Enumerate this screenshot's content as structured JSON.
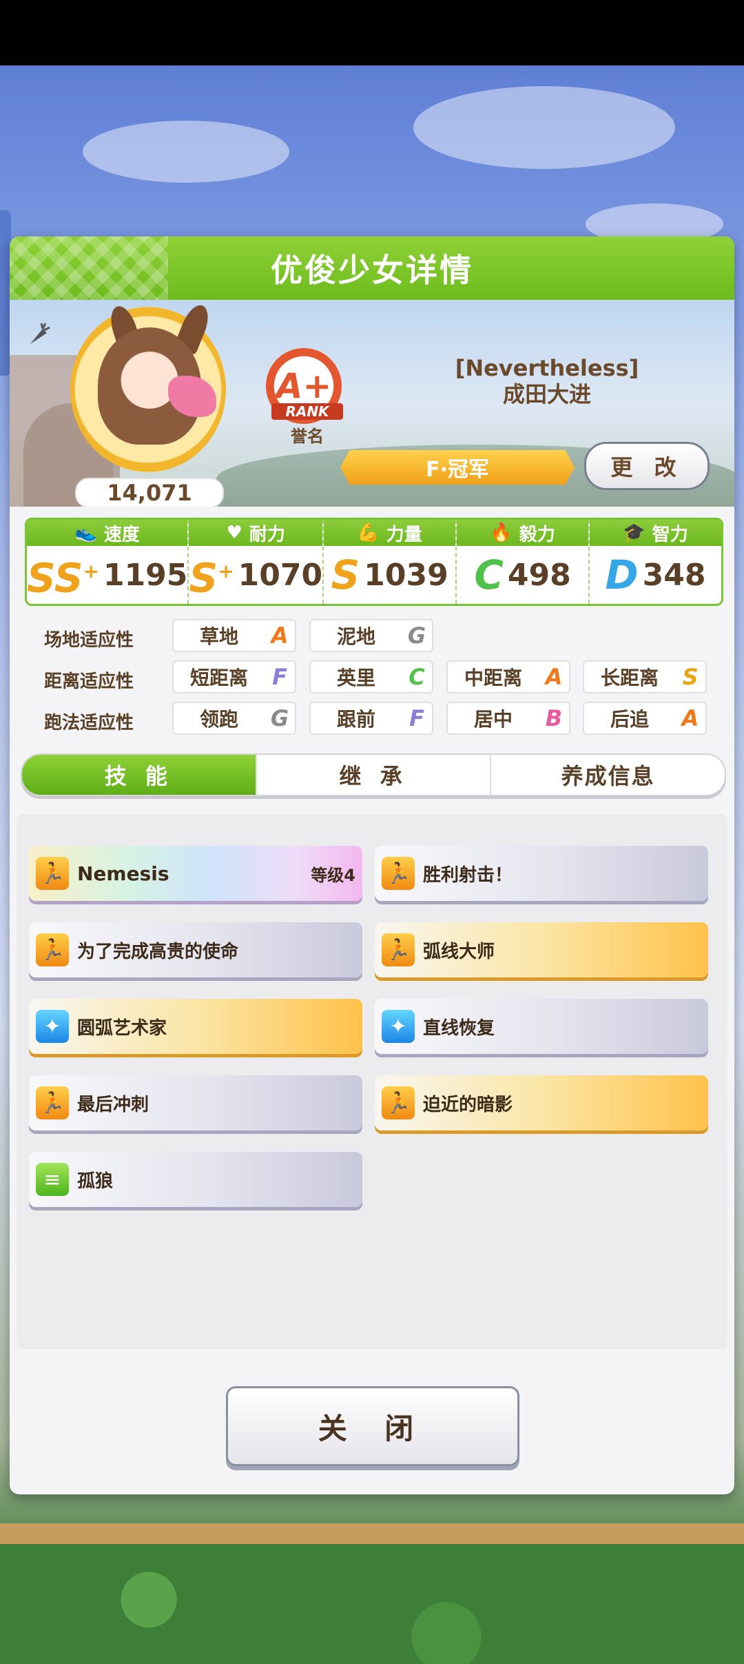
{
  "header": {
    "title": "优俊少女详情"
  },
  "profile": {
    "fan_count": "14,071",
    "rank_grade": "A+",
    "rank_text": "RANK",
    "rank_label": "誉名",
    "epithet": "[Nevertheless]",
    "name": "成田大进",
    "title": "F·冠军",
    "change_button": "更 改"
  },
  "stats": [
    {
      "label": "速度",
      "icon": "speed-icon",
      "glyph": "👟",
      "grade": "SS",
      "plus": "+",
      "value": "1195"
    },
    {
      "label": "耐力",
      "icon": "heart-icon",
      "glyph": "♥",
      "grade": "S",
      "plus": "+",
      "value": "1070"
    },
    {
      "label": "力量",
      "icon": "muscle-icon",
      "glyph": "💪",
      "grade": "S",
      "plus": "",
      "value": "1039"
    },
    {
      "label": "毅力",
      "icon": "flame-icon",
      "glyph": "🔥",
      "grade": "C",
      "plus": "",
      "value": "498"
    },
    {
      "label": "智力",
      "icon": "graduation-cap-icon",
      "glyph": "🎓",
      "grade": "D",
      "plus": "",
      "value": "348"
    }
  ],
  "aptitude": {
    "track": {
      "label": "场地适应性",
      "items": [
        {
          "name": "草地",
          "grade": "A"
        },
        {
          "name": "泥地",
          "grade": "G"
        }
      ]
    },
    "distance": {
      "label": "距离适应性",
      "items": [
        {
          "name": "短距离",
          "grade": "F"
        },
        {
          "name": "英里",
          "grade": "C"
        },
        {
          "name": "中距离",
          "grade": "A"
        },
        {
          "name": "长距离",
          "grade": "S"
        }
      ]
    },
    "style": {
      "label": "跑法适应性",
      "items": [
        {
          "name": "领跑",
          "grade": "G"
        },
        {
          "name": "跟前",
          "grade": "F"
        },
        {
          "name": "居中",
          "grade": "B"
        },
        {
          "name": "后追",
          "grade": "A"
        }
      ]
    }
  },
  "tabs": [
    {
      "label": "技 能"
    },
    {
      "label": "继 承"
    },
    {
      "label": "养成信息"
    }
  ],
  "skills": [
    {
      "name": "Nemesis",
      "level": "等级4",
      "type": "speed-icon"
    },
    {
      "name": "胜利射击！",
      "level": "",
      "type": "speed-icon"
    },
    {
      "name": "为了完成高贵的使命",
      "level": "",
      "type": "speed-icon"
    },
    {
      "name": "弧线大师",
      "level": "",
      "type": "speed-icon"
    },
    {
      "name": "圆弧艺术家",
      "level": "",
      "type": "recovery-icon"
    },
    {
      "name": "直线恢复",
      "level": "",
      "type": "recovery-icon"
    },
    {
      "name": "最后冲刺",
      "level": "",
      "type": "speed-icon"
    },
    {
      "name": "迫近的暗影",
      "level": "",
      "type": "speed-icon"
    },
    {
      "name": "孤狼",
      "level": "",
      "type": "debuff-icon"
    }
  ],
  "close_button": "关 闭",
  "colors": {
    "accent_green": "#6dbb1c",
    "gold": "#ffc24a",
    "text_brown": "#5a3f27"
  }
}
